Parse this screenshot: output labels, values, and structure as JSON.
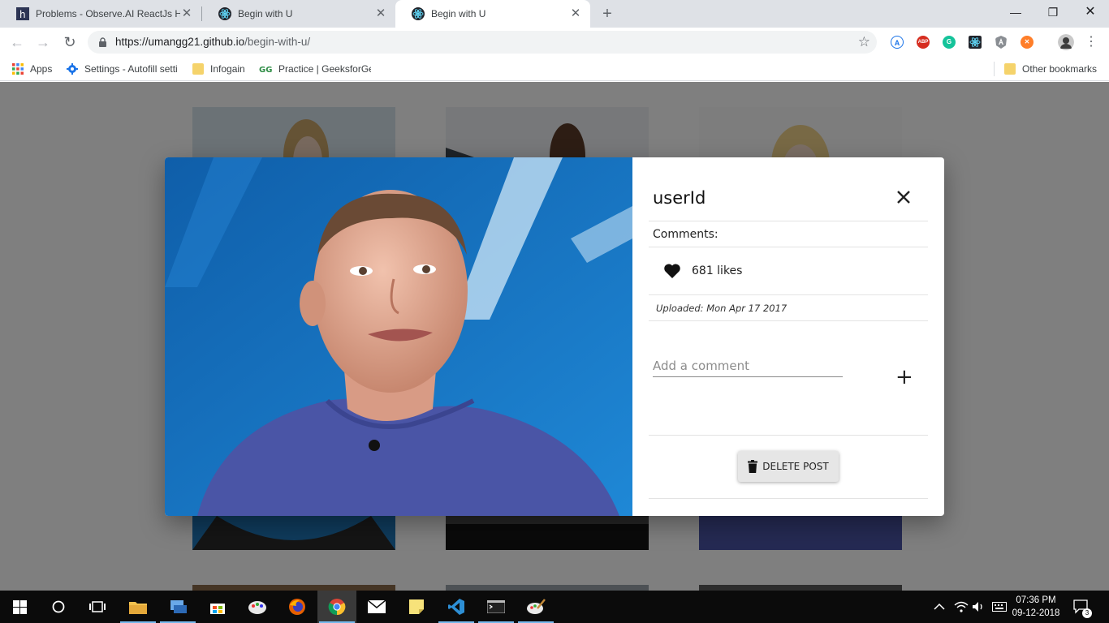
{
  "browser": {
    "tabs": [
      {
        "title": "Problems - Observe.AI ReactJs Hiring",
        "active": false
      },
      {
        "title": "Begin with U",
        "active": false
      },
      {
        "title": "Begin with U",
        "active": true
      }
    ],
    "new_tab_icon": "plus-icon",
    "url_host": "https://umangg21.github.io",
    "url_path": "/begin-with-u/",
    "bookmarks": [
      {
        "label": "Apps",
        "icon": "apps-grid-icon"
      },
      {
        "label": "Settings - Autofill settings",
        "icon": "gear-icon"
      },
      {
        "label": "Infogain",
        "icon": "folder-icon"
      },
      {
        "label": "Practice | GeeksforGeeks",
        "icon": "gfg-icon"
      }
    ],
    "other_bookmarks": "Other bookmarks",
    "extensions": [
      {
        "label": "A",
        "color": "#1a73e8"
      },
      {
        "label": "ABP",
        "color": "#d62d20"
      },
      {
        "label": "G",
        "color": "#15c39a"
      },
      {
        "label": "",
        "color": "#1a73e8"
      },
      {
        "label": "",
        "color": "#9aa0a6"
      },
      {
        "label": "",
        "color": "#ff7e29"
      }
    ]
  },
  "modal": {
    "username": "userId",
    "comments_label": "Comments:",
    "likes": "681 likes",
    "uploaded": "Uploaded: Mon Apr 17 2017",
    "comment_placeholder": "Add a comment",
    "delete_label": "DELETE POST"
  },
  "taskbar": {
    "time": "07:36 PM",
    "date": "09-12-2018",
    "notification_count": "3"
  },
  "colors": {
    "accent": "#1a73e8",
    "photo_bg": "#1b78c9",
    "shirt": "#4a55a6"
  }
}
